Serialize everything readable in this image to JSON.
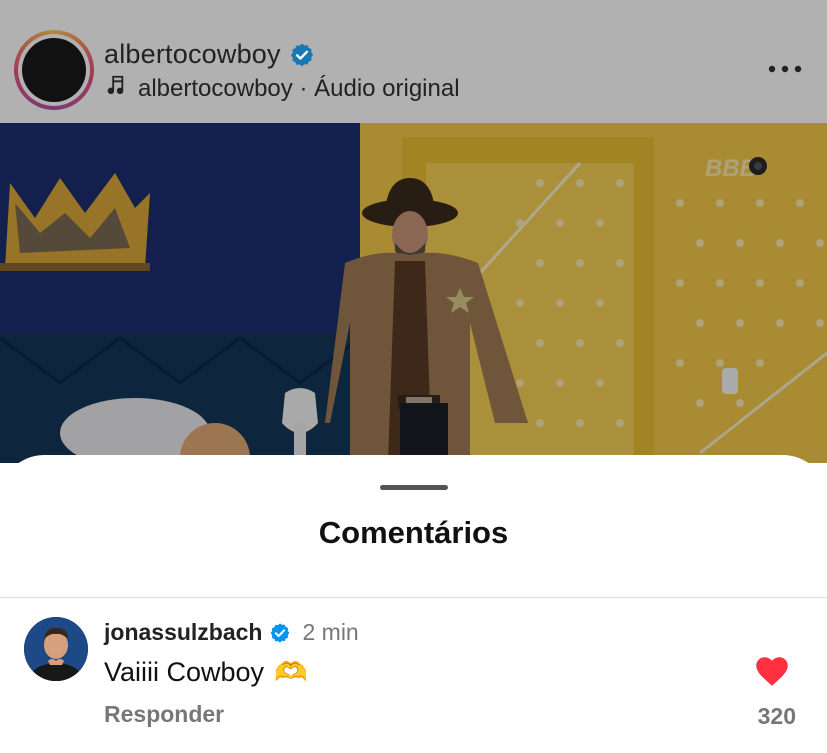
{
  "post": {
    "username": "albertocowboy",
    "audio_user": "albertocowboy",
    "audio_separator": "·",
    "audio_label": "Áudio original",
    "video_overlay_logo": "BBB"
  },
  "sheet": {
    "title": "Comentários"
  },
  "comments": [
    {
      "username": "jonassulzbach",
      "time": "2 min",
      "text": "Vaiiii Cowboy",
      "emoji": "🫶",
      "reply_label": "Responder",
      "like_count": "320",
      "liked": true
    }
  ],
  "colors": {
    "verified": "#0095f6",
    "like": "#ff3040",
    "dim_overlay": "rgba(0,0,0,0.3)"
  },
  "icons": {
    "verified": "verified-badge-icon",
    "audio": "music-note-icon",
    "more": "more-horizontal-icon",
    "like": "heart-filled-icon"
  }
}
